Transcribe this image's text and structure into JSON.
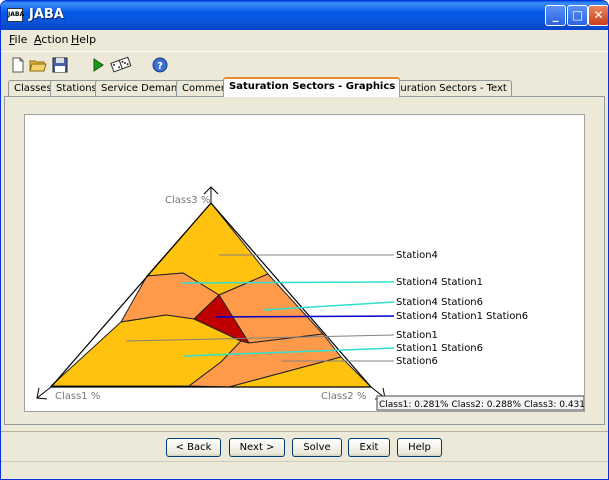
{
  "window": {
    "title": "JABA",
    "app_icon_text": "JABA"
  },
  "window_controls": {
    "minimize": "_",
    "maximize": "□",
    "close": "✕"
  },
  "menu": {
    "file": {
      "key": "F",
      "rest": "ile"
    },
    "action": {
      "key": "A",
      "rest": "ction"
    },
    "help": {
      "key": "H",
      "rest": "elp"
    }
  },
  "toolbar": {
    "icons": [
      "new-file-icon",
      "open-folder-icon",
      "save-disk-icon",
      "run-solve-icon",
      "randomize-dice-icon",
      "help-icon"
    ]
  },
  "tabs": [
    {
      "label": "Classes",
      "active": false
    },
    {
      "label": "Stations",
      "active": false
    },
    {
      "label": "Service Demands",
      "active": false
    },
    {
      "label": "Comment",
      "active": false
    },
    {
      "label": "Saturation Sectors - Graphics",
      "active": true
    },
    {
      "label": "Saturation Sectors - Text",
      "active": false
    }
  ],
  "plot": {
    "axis_top": "Class3 %",
    "axis_left": "Class1 %",
    "axis_right": "Class2 %",
    "legend": [
      {
        "label": "Station4",
        "color": "#808080"
      },
      {
        "label": "Station4 Station1",
        "color": "#2ee0d0"
      },
      {
        "label": "Station4 Station6",
        "color": "#2ee0d0"
      },
      {
        "label": "Station4 Station1 Station6",
        "color": "#0000cc"
      },
      {
        "label": "Station1",
        "color": "#808080"
      },
      {
        "label": "Station1 Station6",
        "color": "#2ee0d0"
      },
      {
        "label": "Station6",
        "color": "#808080"
      }
    ],
    "tooltip": "Class1: 0.281% Class2: 0.288% Class3: 0.431%",
    "colors": {
      "single_station": "#ffc20e",
      "two_stations": "#ff9a4a",
      "three_stations": "#c00000"
    }
  },
  "buttons": {
    "back": "< Back",
    "next": "Next >",
    "solve": "Solve",
    "exit": "Exit",
    "help": "Help"
  }
}
